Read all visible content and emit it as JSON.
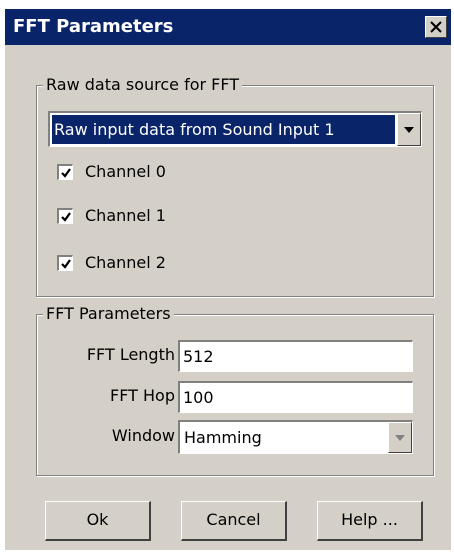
{
  "window": {
    "title": "FFT Parameters",
    "close_glyph": "X"
  },
  "source_group": {
    "legend": "Raw data source for FFT",
    "selected_source": "Raw input data from Sound Input 1",
    "channels": [
      {
        "label": "Channel 0",
        "checked": true
      },
      {
        "label": "Channel 1",
        "checked": true
      },
      {
        "label": "Channel 2",
        "checked": true
      }
    ]
  },
  "params_group": {
    "legend": "FFT Parameters",
    "fft_length_label": "FFT Length",
    "fft_length_value": "512",
    "fft_hop_label": "FFT Hop",
    "fft_hop_value": "100",
    "window_label": "Window",
    "window_value": "Hamming"
  },
  "buttons": {
    "ok": "Ok",
    "cancel": "Cancel",
    "help": "Help ..."
  },
  "colors": {
    "titlebar": "#0a246a",
    "face": "#d4d0c8",
    "selection": "#0a246a"
  }
}
